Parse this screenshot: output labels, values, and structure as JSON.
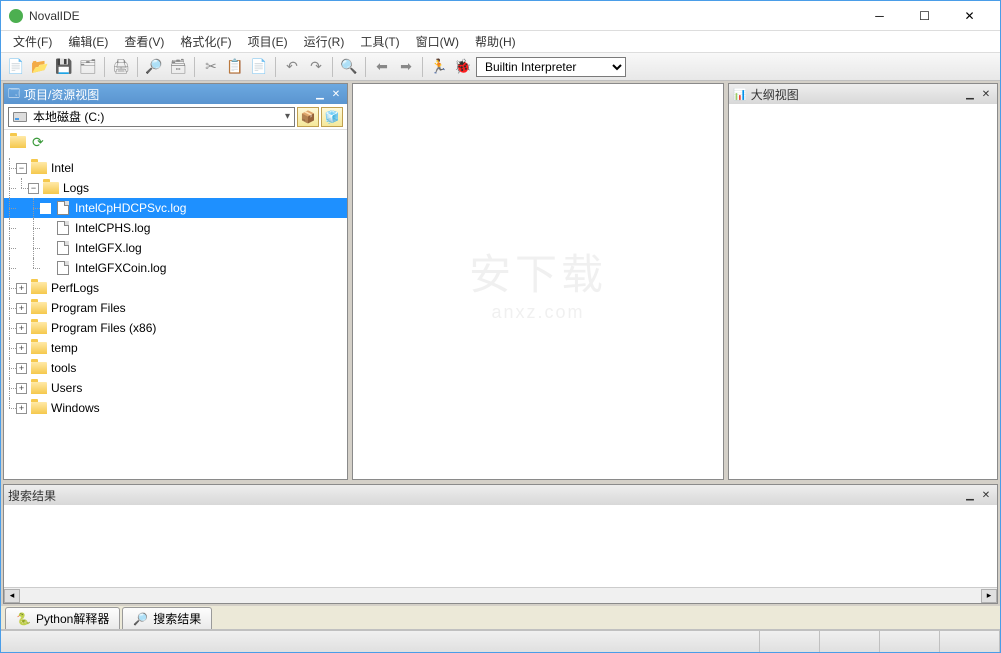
{
  "window": {
    "title": "NovalIDE"
  },
  "menu": [
    {
      "label": "文件(F)"
    },
    {
      "label": "编辑(E)"
    },
    {
      "label": "查看(V)"
    },
    {
      "label": "格式化(F)"
    },
    {
      "label": "项目(E)"
    },
    {
      "label": "运行(R)"
    },
    {
      "label": "工具(T)"
    },
    {
      "label": "窗口(W)"
    },
    {
      "label": "帮助(H)"
    }
  ],
  "toolbar": {
    "interpreter": "Builtin Interpreter"
  },
  "panels": {
    "project_title": "项目/资源视图",
    "outline_title": "大纲视图",
    "search_title": "搜索结果"
  },
  "drive": {
    "label": "本地磁盘 (C:)"
  },
  "tree": {
    "root": [
      {
        "name": "Intel",
        "type": "folder",
        "expanded": true,
        "children": [
          {
            "name": "Logs",
            "type": "folder",
            "expanded": true,
            "children": [
              {
                "name": "IntelCpHDCPSvc.log",
                "type": "file",
                "selected": true
              },
              {
                "name": "IntelCPHS.log",
                "type": "file"
              },
              {
                "name": "IntelGFX.log",
                "type": "file"
              },
              {
                "name": "IntelGFXCoin.log",
                "type": "file"
              }
            ]
          }
        ]
      },
      {
        "name": "PerfLogs",
        "type": "folder"
      },
      {
        "name": "Program Files",
        "type": "folder"
      },
      {
        "name": "Program Files (x86)",
        "type": "folder"
      },
      {
        "name": "temp",
        "type": "folder"
      },
      {
        "name": "tools",
        "type": "folder"
      },
      {
        "name": "Users",
        "type": "folder"
      },
      {
        "name": "Windows",
        "type": "folder"
      }
    ]
  },
  "bottom_tabs": [
    {
      "label": "Python解释器",
      "icon": "python-icon"
    },
    {
      "label": "搜索结果",
      "icon": "search-result-icon"
    }
  ],
  "watermark": {
    "line1": "安下载",
    "line2": "anxz.com"
  }
}
